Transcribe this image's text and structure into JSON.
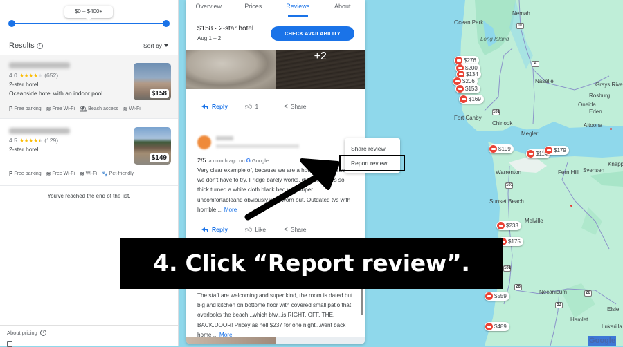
{
  "left_panel": {
    "price_range_label": "$0 – $400+",
    "price_range_slider": {
      "min_fraction": 0.0,
      "max_fraction": 1.0
    },
    "results_label": "Results",
    "sort_label": "Sort by",
    "hotels": [
      {
        "name": "Silver Sands Motel",
        "rating": "4.0",
        "stars_filled": 4,
        "review_count": "(652)",
        "class": "2-star hotel",
        "description": "Oceanside hotel with an indoor pool",
        "price": "$158",
        "amenities": [
          {
            "icon": "parking-icon",
            "glyph": "P",
            "label": "Free parking"
          },
          {
            "icon": "wifi-icon",
            "glyph": "≋",
            "label": "Free Wi-Fi"
          },
          {
            "icon": "beach-icon",
            "glyph": "⛱",
            "label": "Beach access"
          },
          {
            "icon": "wifi-icon",
            "glyph": "≋",
            "label": "Wi-Fi"
          }
        ]
      },
      {
        "name": "Silver Sands Motel",
        "rating": "4.5",
        "stars_filled": 4.5,
        "review_count": "(129)",
        "class": "2-star hotel",
        "description": "",
        "price": "$149",
        "amenities": [
          {
            "icon": "parking-icon",
            "glyph": "P",
            "label": "Free parking"
          },
          {
            "icon": "wifi-icon",
            "glyph": "≋",
            "label": "Free Wi-Fi"
          },
          {
            "icon": "wifi-icon",
            "glyph": "≋",
            "label": "Wi-Fi"
          },
          {
            "icon": "paw-icon",
            "glyph": "🐾",
            "label": "Pet-friendly"
          }
        ]
      }
    ],
    "end_of_list": "You've reached the end of the list.",
    "about_pricing": "About pricing"
  },
  "detail": {
    "tabs": [
      {
        "label": "Overview",
        "active": false
      },
      {
        "label": "Prices",
        "active": false
      },
      {
        "label": "Reviews",
        "active": true
      },
      {
        "label": "About",
        "active": false
      }
    ],
    "summary_price": "$158 · 2-star hotel",
    "summary_dates": "Aug 1 – 2",
    "check_availability": "CHECK AVAILABILITY",
    "photo_more": "+2",
    "review1_actions": {
      "reply": "Reply",
      "like_count": "1",
      "share": "Share"
    },
    "review2": {
      "score": "2/5",
      "when": "a month ago on",
      "source": "Google",
      "text": "Very clear example of, because we are a hotel on the beach we don't have to try. Fridge barely works, dust on chairs so thick turned a white cloth black bed was super uncomfortableand obviously very worn out. Outdated tvs with horrible ...",
      "more": "More",
      "actions": {
        "reply": "Reply",
        "like": "Like",
        "share": "Share"
      }
    },
    "review3": {
      "text": "The staff are welcoming and super kind, the room is dated but big and kitchen on bottome floor with covered small patio that overlooks the beach...which btw...is RIGHT. OFF. THE. BACK.DOOR! Pricey as hell $237 for one night...went back home ...",
      "more": "More"
    }
  },
  "context_menu": {
    "items": [
      "Share review",
      "Report review"
    ],
    "highlighted": "Report review"
  },
  "instruction": "4. Click “Report review”.",
  "map": {
    "labels": [
      {
        "text": "Ocean Park"
      },
      {
        "text": "Nemah"
      },
      {
        "text": "Long Island"
      },
      {
        "text": "Naselle"
      },
      {
        "text": "Grays River"
      },
      {
        "text": "Rosburg"
      },
      {
        "text": "Oneida"
      },
      {
        "text": "Eden"
      },
      {
        "text": "Fort Canby"
      },
      {
        "text": "Chinook"
      },
      {
        "text": "Megler"
      },
      {
        "text": "Altoona"
      },
      {
        "text": "Warrenton"
      },
      {
        "text": "Fern Hill"
      },
      {
        "text": "Svensen"
      },
      {
        "text": "Knappa"
      },
      {
        "text": "Sunset Beach"
      },
      {
        "text": "Melville"
      },
      {
        "text": "Necanicum"
      },
      {
        "text": "Hamlet"
      },
      {
        "text": "Elsie"
      },
      {
        "text": "Lukarilla"
      }
    ],
    "routes": [
      "101",
      "4",
      "101",
      "101",
      "101",
      "26",
      "53",
      "26"
    ],
    "price_pins": [
      "$276",
      "$200",
      "$134",
      "$206",
      "$153",
      "$169",
      "$199",
      "$114",
      "$179",
      "$233",
      "$175",
      "$559",
      "$489"
    ],
    "attribution": "Google"
  }
}
